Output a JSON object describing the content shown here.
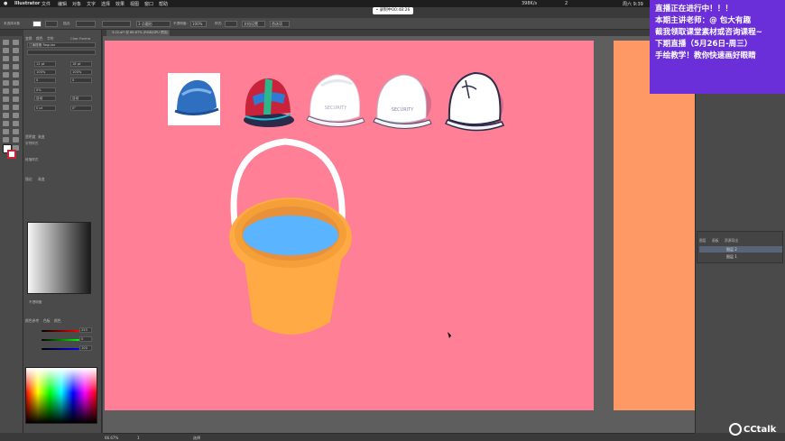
{
  "menubar": {
    "apple_icon": "apple-icon",
    "app_name": "Illustrator",
    "items": [
      "文件",
      "编辑",
      "对象",
      "文字",
      "选择",
      "效果",
      "视图",
      "窗口",
      "帮助"
    ],
    "right_status": [
      "398K/s",
      "2"
    ],
    "time": "周六 9:39"
  },
  "recording_badge": "• 录制中00:48:26",
  "options_bar": {
    "selection_label": "未选择对象",
    "stroke_label": "描边:",
    "point_label": "3 点圆形",
    "opacity_label": "不透明度:",
    "opacity_value": "100%",
    "style_label": "样式:",
    "doc_setup": "文档设置",
    "preferences": "首选项"
  },
  "document_tab": "3.02.ai* @ 66.67% (RGB/GPU 预览)",
  "left_panel": {
    "tabs": [
      "变换",
      "颜色",
      "字符",
      "Char Forma"
    ],
    "font_family": "江南楼雅 Regular",
    "font_size": "12 pt",
    "leading": "18 pt",
    "scale_h": "100%",
    "scale_v": "100%",
    "tracking": "0",
    "kerning": "自动",
    "tracking2": "0%",
    "baseline": "0 pt",
    "rotate": "0°",
    "auto1": "自动",
    "auto2": "自动",
    "section_char_styles": "字符样式",
    "section_para_styles": "段落样式",
    "glyph_tabs": [
      "透明度",
      "渐变"
    ],
    "gradient_tabs": [
      "描边",
      "渐变"
    ],
    "opacity_value": "不透明度",
    "color_tabs": [
      "颜色参考",
      "色板",
      "颜色"
    ],
    "color_values": [
      "255",
      "0",
      "100"
    ]
  },
  "layers_panel": {
    "tabs": [
      "图层",
      "画板",
      "资源导出"
    ],
    "rows": [
      "图层 2",
      "图层 1"
    ]
  },
  "status_bar": {
    "zoom": "66.67%",
    "artboard": "1",
    "mode": "选择"
  },
  "announcement": {
    "lines": [
      "直播正在进行中！！！",
      "本期主讲老师：@ 包大有趣",
      "截我领取课堂素材或咨询课程~",
      "",
      "下期直播（5月26日-周三）",
      "手绘教学！教你快速画好眼睛"
    ]
  },
  "cctalk_logo": "CCtalk",
  "artwork": {
    "helmet_label": "SECURITY",
    "colors": {
      "artboard": "#fe7f96",
      "artboard2": "#fe9966",
      "bucket": "#ffaa44",
      "bucket_rim": "#f49f37",
      "water": "#5ab4ff",
      "handle": "#ffffff",
      "helmet_blue": "#2f6fc0"
    }
  }
}
